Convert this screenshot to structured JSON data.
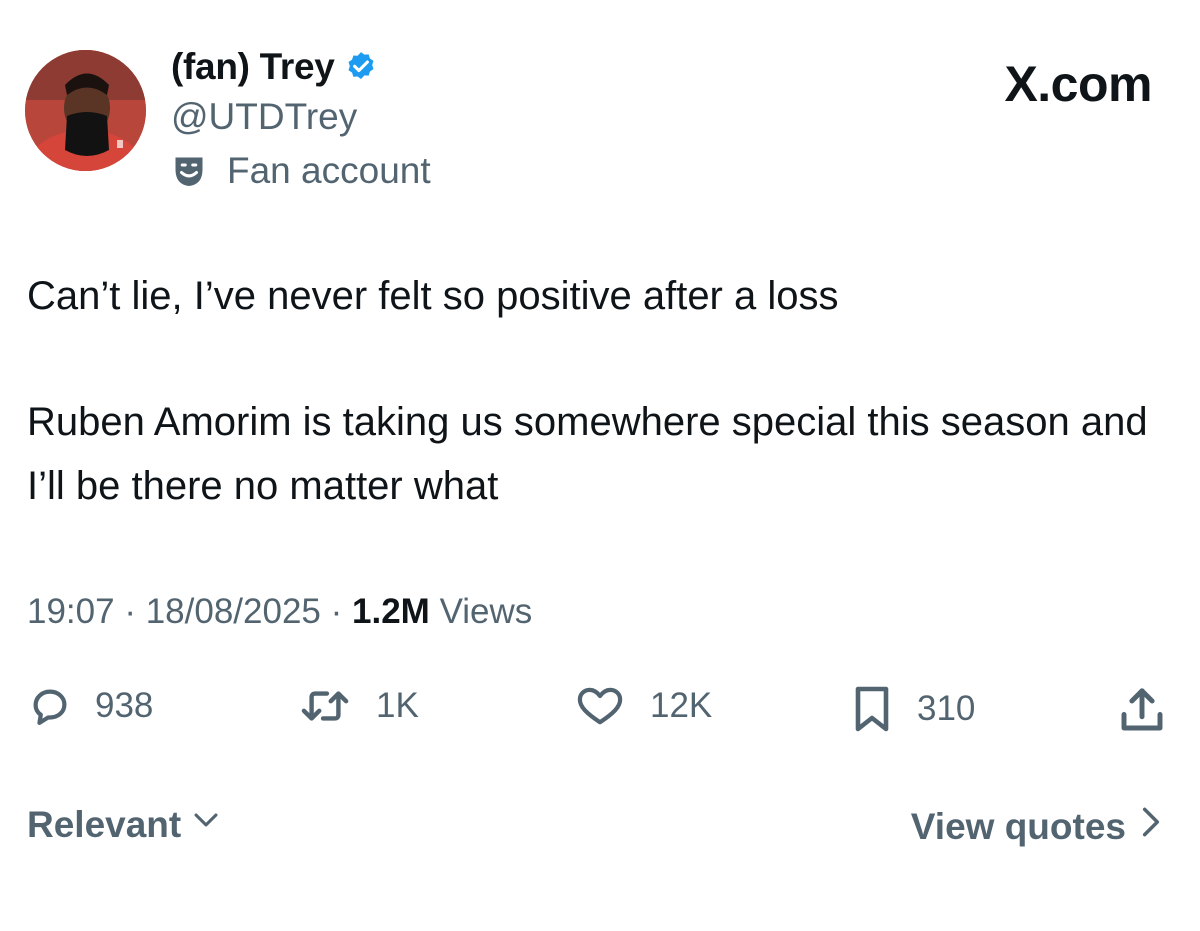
{
  "header": {
    "display_name": "(fan) Trey",
    "handle": "@UTDTrey",
    "account_label": "Fan account",
    "brand": "X.com"
  },
  "tweet": {
    "paragraphs": [
      "Can’t lie, I’ve never felt so positive after a loss",
      "Ruben Amorim is taking us somewhere special this season and I’ll be there no matter what"
    ],
    "time": "19:07",
    "date": "18/08/2025",
    "views_count": "1.2M",
    "views_label": "Views"
  },
  "actions": {
    "replies": "938",
    "reposts": "1K",
    "likes": "12K",
    "bookmarks": "310"
  },
  "footer": {
    "sort_label": "Relevant",
    "view_quotes_label": "View quotes"
  },
  "icons": {
    "verified": "verified-badge-icon",
    "account_label": "theater-mask-icon",
    "reply": "speech-bubble-icon",
    "repost": "repost-icon",
    "like": "heart-icon",
    "bookmark": "bookmark-icon",
    "share": "share-icon"
  },
  "colors": {
    "text": "#0f1419",
    "secondary": "#536471",
    "verified": "#1d9bf0",
    "background": "#ffffff"
  }
}
